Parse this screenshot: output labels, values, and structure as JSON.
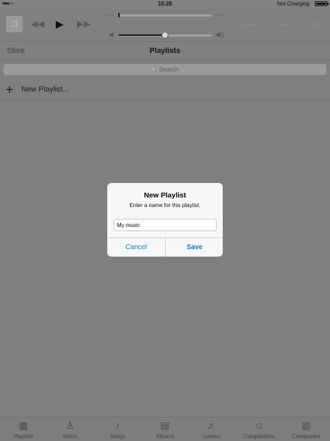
{
  "status_bar": {
    "signal": "●●●○○",
    "time": "15:28",
    "charging": "Not Charging"
  },
  "player": {
    "elapsed": "--:--",
    "remaining": "-:--:--",
    "buttons": {
      "repeat": "Repeat",
      "create": "Create",
      "shuffle": "Shuffle"
    },
    "icons": {
      "album_art": "♫",
      "previous": "◀◀",
      "play": "▶",
      "next": "▶▶",
      "volume_low": "◀",
      "volume_high": "◀))"
    },
    "volume_level": 0.5
  },
  "nav": {
    "store": "Store",
    "title": "Playlists"
  },
  "search": {
    "icon": "🔍",
    "placeholder": "Search"
  },
  "new_playlist": {
    "icon": "+",
    "label": "New Playlist..."
  },
  "dialog": {
    "title": "New Playlist",
    "message": "Enter a name for this playlist.",
    "input_value": "My music",
    "cancel": "Cancel",
    "save": "Save"
  },
  "tabs": [
    {
      "label": "Playlists",
      "icon": "▦"
    },
    {
      "label": "Artists",
      "icon": "♙"
    },
    {
      "label": "Songs",
      "icon": "♪"
    },
    {
      "label": "Albums",
      "icon": "▤"
    },
    {
      "label": "Genres",
      "icon": "♬"
    },
    {
      "label": "Compilations",
      "icon": "☺"
    },
    {
      "label": "Composers",
      "icon": "▥"
    }
  ],
  "colors": {
    "accent": "#1a76c8",
    "overlay": "#7f7f7f"
  }
}
